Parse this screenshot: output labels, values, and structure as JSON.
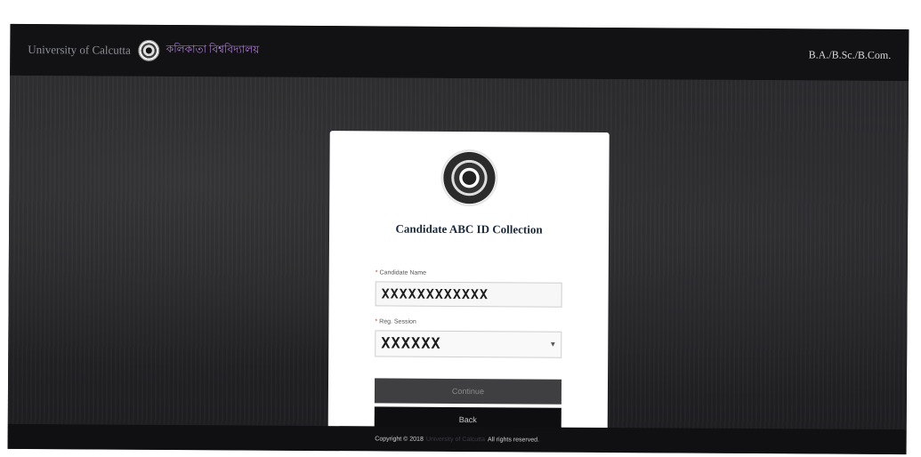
{
  "header": {
    "brand_en": "University of Calcutta",
    "brand_bn": "কলিকাতা বিশ্ববিদ্যালয়",
    "course_link": "B.A./B.Sc./B.Com."
  },
  "card": {
    "title": "Candidate ABC ID Collection",
    "fields": {
      "candidate_label": "Candidate Name",
      "candidate_value": "XXXXXXXXXXXX",
      "reg_label": "Reg. Session",
      "reg_value": "XXXXXX"
    },
    "buttons": {
      "continue": "Continue",
      "back": "Back"
    }
  },
  "footer": {
    "copyright": "Copyright © 2018",
    "owner": "University of Calcutta",
    "rights": "All rights reserved."
  }
}
